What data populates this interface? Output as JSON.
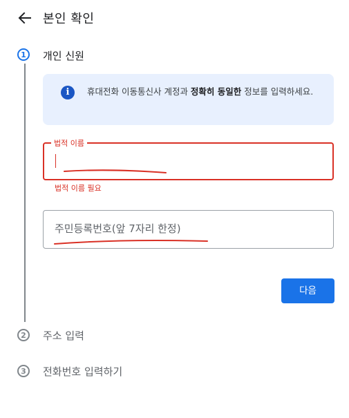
{
  "header": {
    "title": "본인 확인",
    "back_icon": "arrow-left-icon"
  },
  "steps": [
    {
      "number": "1",
      "label": "개인 신원",
      "state": "active"
    },
    {
      "number": "2",
      "label": "주소 입력",
      "state": "inactive"
    },
    {
      "number": "3",
      "label": "전화번호 입력하기",
      "state": "inactive"
    }
  ],
  "info": {
    "icon": "info-icon",
    "text_part1": "휴대전화 이동통신사 계정과 ",
    "text_bold": "정확히 동일한",
    "text_part2": " 정보를 입력하세요."
  },
  "legal_name": {
    "label": "법적 이름",
    "value": "",
    "error": "법적 이름 필요"
  },
  "resident_number": {
    "placeholder": "주민등록번호(앞 7자리 한정)",
    "value": ""
  },
  "next_button": {
    "label": "다음"
  },
  "colors": {
    "accent": "#1a73e8",
    "error": "#d93025",
    "info_bg": "#e8f0fe"
  }
}
